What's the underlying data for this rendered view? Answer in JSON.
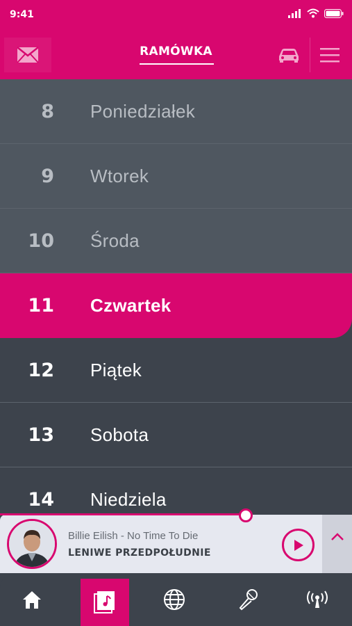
{
  "status_bar": {
    "time": "9:41"
  },
  "header": {
    "title": "RAMÓWKA",
    "mail_icon": "mail-icon",
    "car_icon": "car-icon",
    "menu_icon": "hamburger-menu-icon"
  },
  "days": [
    {
      "number": "8",
      "name": "Poniedziałek",
      "state": "past"
    },
    {
      "number": "9",
      "name": "Wtorek",
      "state": "past"
    },
    {
      "number": "10",
      "name": "Środa",
      "state": "past"
    },
    {
      "number": "11",
      "name": "Czwartek",
      "state": "active"
    },
    {
      "number": "12",
      "name": "Piątek",
      "state": "future"
    },
    {
      "number": "13",
      "name": "Sobota",
      "state": "future"
    },
    {
      "number": "14",
      "name": "Niedziela",
      "state": "future"
    }
  ],
  "player": {
    "track": "Billie Eilish  - No Time To Die",
    "show": "LENIWE PRZEDPOŁUDNIE",
    "progress": 0.7
  },
  "bottom_nav": [
    {
      "icon": "home-icon",
      "active": false
    },
    {
      "icon": "music-note-icon",
      "active": true
    },
    {
      "icon": "globe-icon",
      "active": false
    },
    {
      "icon": "microphone-icon",
      "active": false
    },
    {
      "icon": "broadcast-icon",
      "active": false
    }
  ],
  "colors": {
    "accent": "#d8076f",
    "past_bg": "#4f5760",
    "future_bg": "#3d434c",
    "player_bg": "#e6e8f0"
  }
}
